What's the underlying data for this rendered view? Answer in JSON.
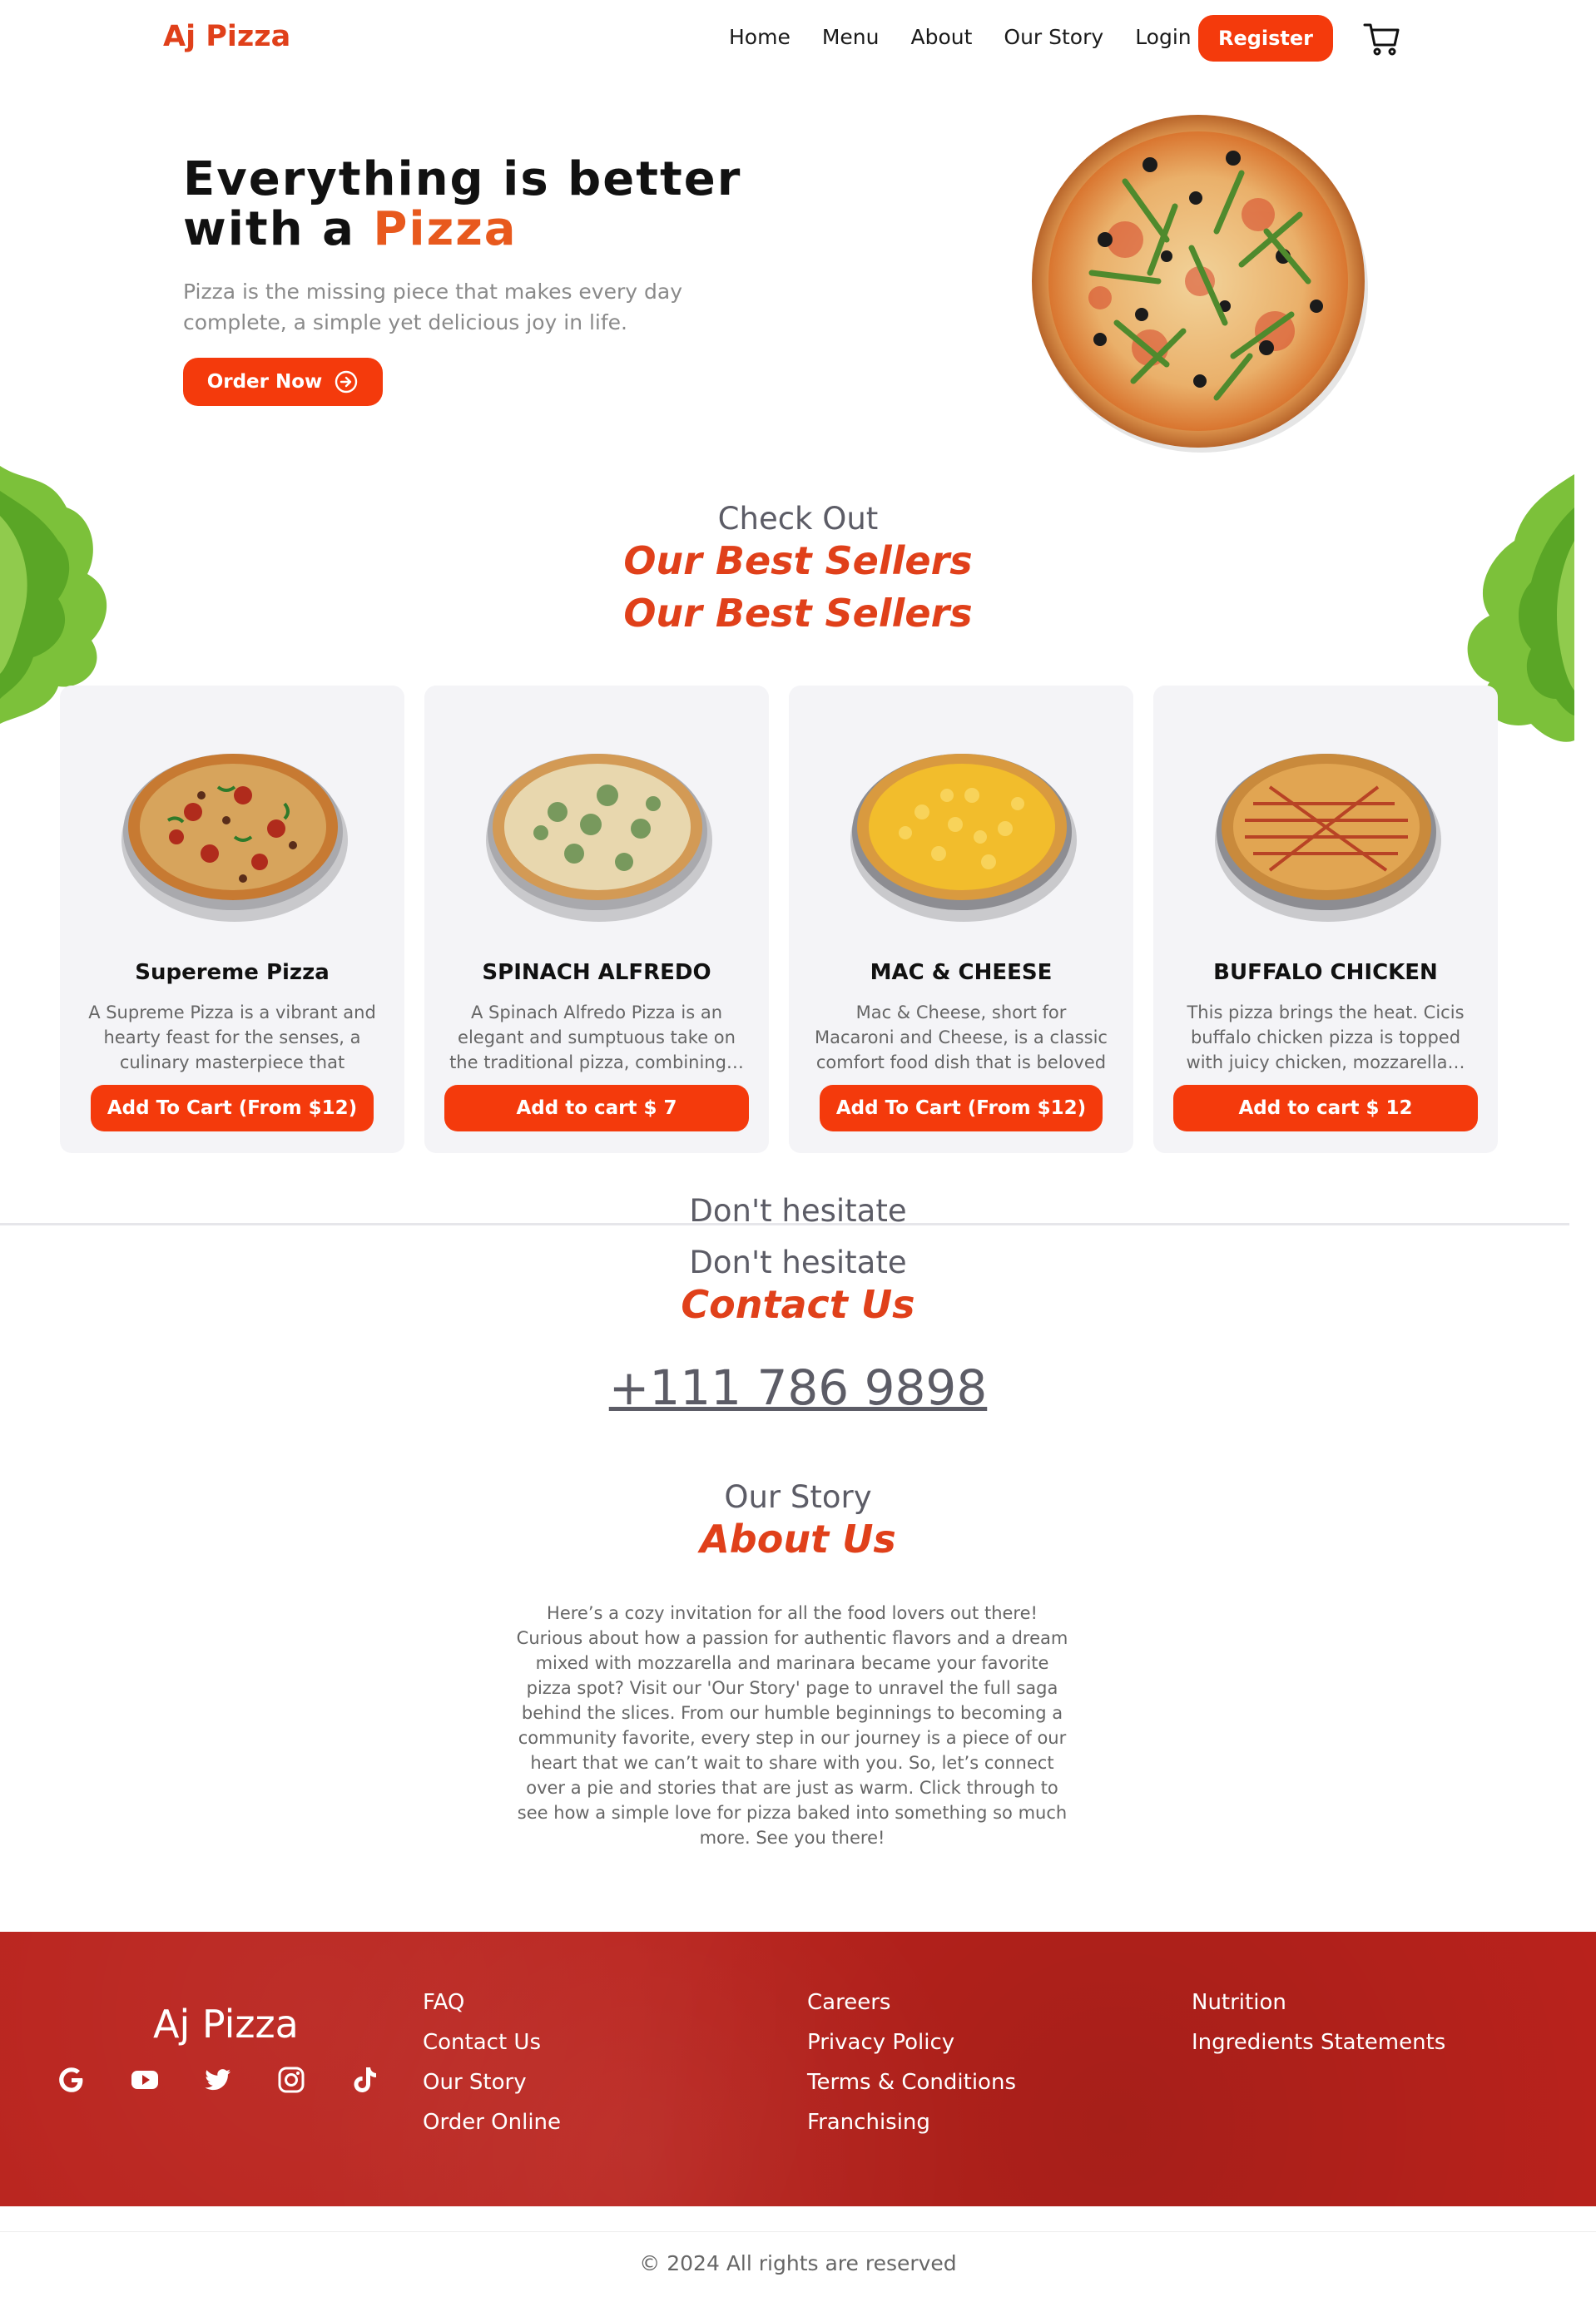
{
  "nav": {
    "brand": "Aj Pizza",
    "links": [
      "Home",
      "Menu",
      "About",
      "Our Story",
      "Login"
    ],
    "register": "Register"
  },
  "hero": {
    "title_line1": "Everything is better",
    "title_line2_prefix": "with a ",
    "title_line2_accent": "Pizza",
    "subtitle": "Pizza is the missing piece that makes every day complete, a simple yet delicious joy in life.",
    "cta": "Order Now"
  },
  "bestsellers": {
    "kicker": "Check Out",
    "heading": "Our Best Sellers",
    "heading_ghost": "Our Best Sellers",
    "cards": [
      {
        "title": "Supereme Pizza",
        "desc": "A Supreme Pizza is a vibrant and hearty feast for the senses, a culinary masterpiece that stands…",
        "button": "Add To Cart (From $12)"
      },
      {
        "title": "SPINACH ALFREDO",
        "desc": "A Spinach Alfredo Pizza is an elegant and sumptuous take on the traditional pizza, combining…",
        "button": "Add to cart $ 7"
      },
      {
        "title": "MAC & CHEESE",
        "desc": "Mac & Cheese, short for Macaroni and Cheese, is a classic comfort food dish that is beloved by man…",
        "button": "Add To Cart (From $12)"
      },
      {
        "title": "BUFFALO CHICKEN",
        "desc": "This pizza brings the heat. Cicis buffalo chicken pizza is topped with juicy chicken, mozzarella…",
        "button": "Add to cart $ 12"
      }
    ]
  },
  "contact": {
    "kicker_ghost": "Don't hesitate",
    "kicker": "Don't hesitate",
    "heading": "Contact Us",
    "phone": "+111 786 9898"
  },
  "about": {
    "kicker": "Our Story",
    "heading": "About Us",
    "text": "Here’s a cozy invitation for all the food lovers out there! Curious about how a passion for authentic flavors and a dream mixed with mozzarella and marinara became your favorite pizza spot? Visit our 'Our Story' page to unravel the full saga behind the slices. From our humble beginnings to becoming a community favorite, every step in our journey is a piece of our heart that we can’t wait to share with you. So, let’s connect over a pie and stories that are just as warm. Click through to see how a simple love for pizza baked into something so much more. See you there!"
  },
  "footer": {
    "brand": "Aj Pizza",
    "socials": [
      "google-icon",
      "youtube-icon",
      "twitter-icon",
      "instagram-icon",
      "tiktok-icon"
    ],
    "col1": [
      "FAQ",
      "Contact Us",
      "Our Story",
      "Order Online"
    ],
    "col2": [
      "Careers",
      "Privacy Policy",
      "Terms & Conditions",
      "Franchising"
    ],
    "col3": [
      "Nutrition",
      "Ingredients Statements"
    ],
    "copyright": "© 2024 All rights are reserved"
  },
  "colors": {
    "accent": "#f43a0c",
    "brand": "#e0401a",
    "footer": "#b9221c"
  }
}
